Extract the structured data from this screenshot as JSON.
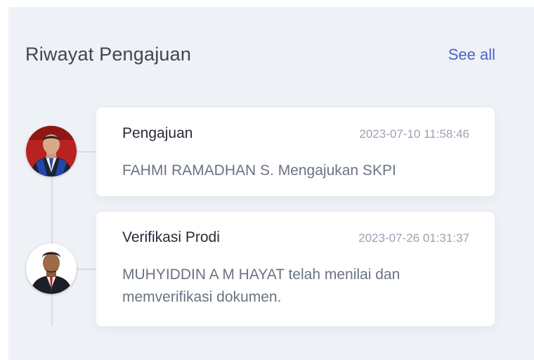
{
  "panel": {
    "title": "Riwayat Pengajuan",
    "see_all": "See all"
  },
  "history": [
    {
      "title": "Pengajuan",
      "time": "2023-07-10 11:58:46",
      "text": "FAHMI RAMADHAN S. Mengajukan SKPI",
      "avatar": "person-avatar-red-background"
    },
    {
      "title": "Verifikasi Prodi",
      "time": "2023-07-26 01:31:37",
      "text": "MUHYIDDIN A M HAYAT telah menilai dan memverifikasi dokumen.",
      "avatar": "person-avatar-white-background"
    }
  ],
  "colors": {
    "panel_bg": "#eef1f6",
    "link": "#4d62c9",
    "title_text": "#3f4554",
    "muted_text": "#9aa3b2"
  }
}
